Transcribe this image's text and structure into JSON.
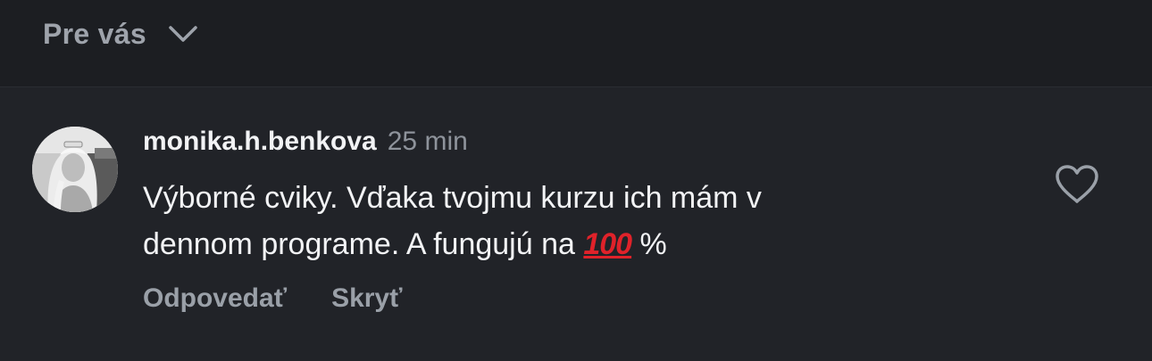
{
  "sort": {
    "label": "Pre vás"
  },
  "comment": {
    "username": "monika.h.benkova",
    "time": "25 min",
    "text_line1": "Výborné cviky. Vďaka tvojmu kurzu ich mám v",
    "text_line2_before": "dennom programe. A fungujú na",
    "emoji_text": "100",
    "emoji_name": "hundred-points-emoji",
    "text_line2_after": "%",
    "reply_label": "Odpovedať",
    "hide_label": "Skryť"
  },
  "icons": {
    "sort_chevron": "chevron-down-icon",
    "like": "heart-outline-icon"
  },
  "colors": {
    "background": "#212328",
    "top_bar": "#1c1e22",
    "primary_text": "#f2f3f5",
    "secondary_text": "#9aa0a8",
    "emoji_red": "#e0222a"
  }
}
